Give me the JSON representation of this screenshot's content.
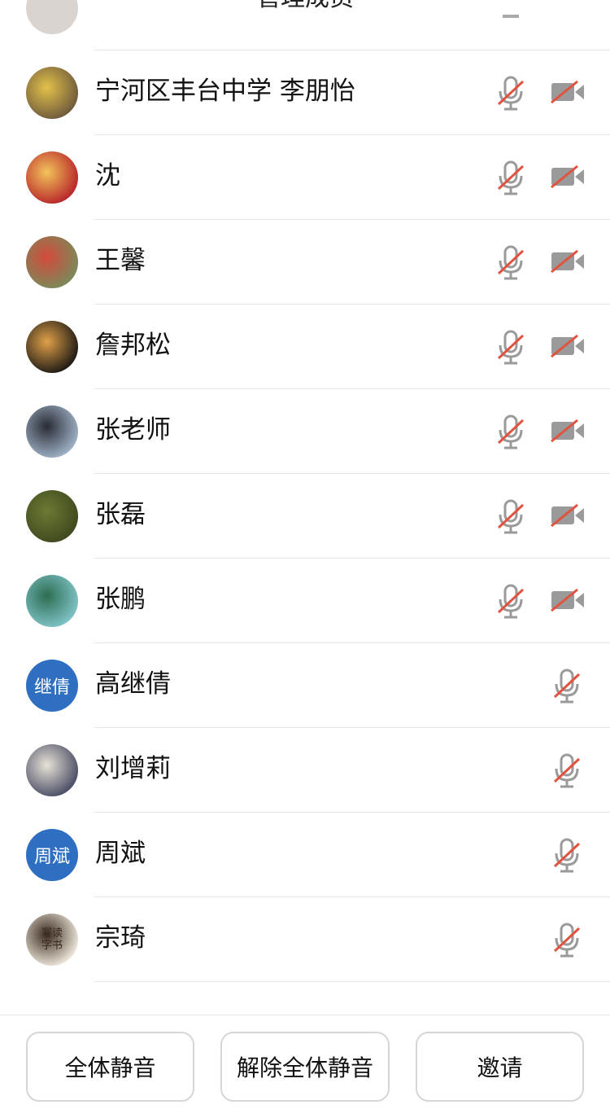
{
  "header": {
    "title": "管理成员",
    "close_icon": "close-icon"
  },
  "participants": [
    {
      "name": "宁河区丰台中学 李朋怡",
      "avatar_type": "image",
      "avatar_colors": [
        "#6f5a3c",
        "#e3c14a"
      ],
      "mic": "muted",
      "camera": "off"
    },
    {
      "name": "沈",
      "avatar_type": "image",
      "avatar_colors": [
        "#b8262a",
        "#f2c35a"
      ],
      "mic": "muted",
      "camera": "off"
    },
    {
      "name": "王馨",
      "avatar_type": "image",
      "avatar_colors": [
        "#7a8a5a",
        "#d44a3a"
      ],
      "mic": "muted",
      "camera": "off"
    },
    {
      "name": "詹邦松",
      "avatar_type": "image",
      "avatar_colors": [
        "#1e1a14",
        "#e0a04a"
      ],
      "mic": "muted",
      "camera": "off"
    },
    {
      "name": "张老师",
      "avatar_type": "image",
      "avatar_colors": [
        "#9fb2c8",
        "#2a2c34"
      ],
      "mic": "muted",
      "camera": "off"
    },
    {
      "name": "张磊",
      "avatar_type": "image",
      "avatar_colors": [
        "#3f4a1e",
        "#6b7a34"
      ],
      "mic": "muted",
      "camera": "off"
    },
    {
      "name": "张鹏",
      "avatar_type": "image",
      "avatar_colors": [
        "#7fc3c7",
        "#2d6d52"
      ],
      "mic": "muted",
      "camera": "off"
    },
    {
      "name": "高继倩",
      "avatar_type": "text",
      "avatar_text": "继倩",
      "avatar_colors": [
        "#2f6fc1"
      ],
      "mic": "muted"
    },
    {
      "name": "刘增莉",
      "avatar_type": "image",
      "avatar_colors": [
        "#4a4e66",
        "#e8e2d6"
      ],
      "mic": "muted"
    },
    {
      "name": "周斌",
      "avatar_type": "text",
      "avatar_text": "周斌",
      "avatar_colors": [
        "#2f6fc1"
      ],
      "mic": "muted"
    },
    {
      "name": "宗琦",
      "avatar_type": "image",
      "avatar_text": "写读字书",
      "avatar_colors": [
        "#efe8dc",
        "#3a2a1e"
      ],
      "mic": "muted"
    }
  ],
  "icons": {
    "mic": "mic-muted-icon",
    "camera": "camera-off-icon"
  },
  "colors": {
    "muted_slash": "#e0533f",
    "icon_gray": "#9a9a9a",
    "accent_blue": "#2f6fc1"
  },
  "footer": {
    "mute_all_label": "全体静音",
    "unmute_all_label": "解除全体静音",
    "invite_label": "邀请"
  }
}
